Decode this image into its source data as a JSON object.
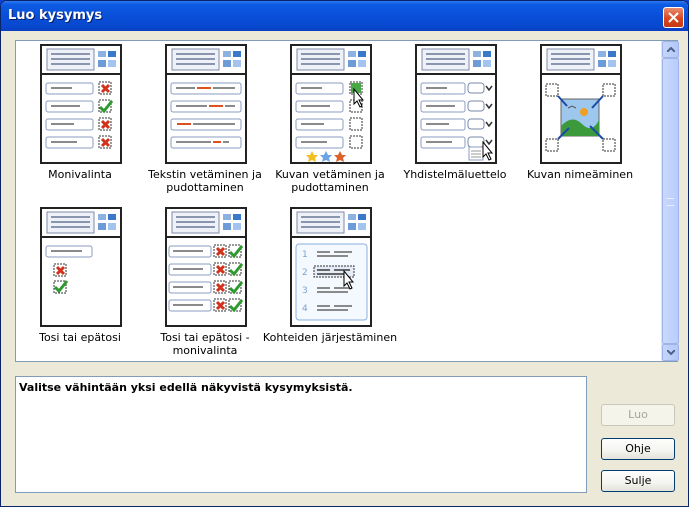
{
  "window": {
    "title": "Luo kysymys"
  },
  "gallery": {
    "items": [
      {
        "label": "Monivalinta",
        "icon": "multiple-choice-icon"
      },
      {
        "label": "Tekstin vetäminen ja pudottaminen",
        "icon": "text-drag-drop-icon"
      },
      {
        "label": "Kuvan vetäminen ja pudottaminen",
        "icon": "image-drag-drop-icon"
      },
      {
        "label": "Yhdistelmäluettelo",
        "icon": "combo-list-icon"
      },
      {
        "label": "Kuvan nimeäminen",
        "icon": "image-labeling-icon"
      },
      {
        "label": "Tosi tai epätosi",
        "icon": "true-false-icon"
      },
      {
        "label": "Tosi tai epätosi -monivalinta",
        "icon": "true-false-multi-icon"
      },
      {
        "label": "Kohteiden järjestäminen",
        "icon": "ordering-icon"
      }
    ]
  },
  "message": "Valitse vähintään yksi edellä näkyvistä kysymyksistä.",
  "buttons": {
    "create": "Luo",
    "help": "Ohje",
    "close": "Sulje"
  },
  "ordering_numbers": [
    "1",
    "2",
    "3",
    "4"
  ]
}
